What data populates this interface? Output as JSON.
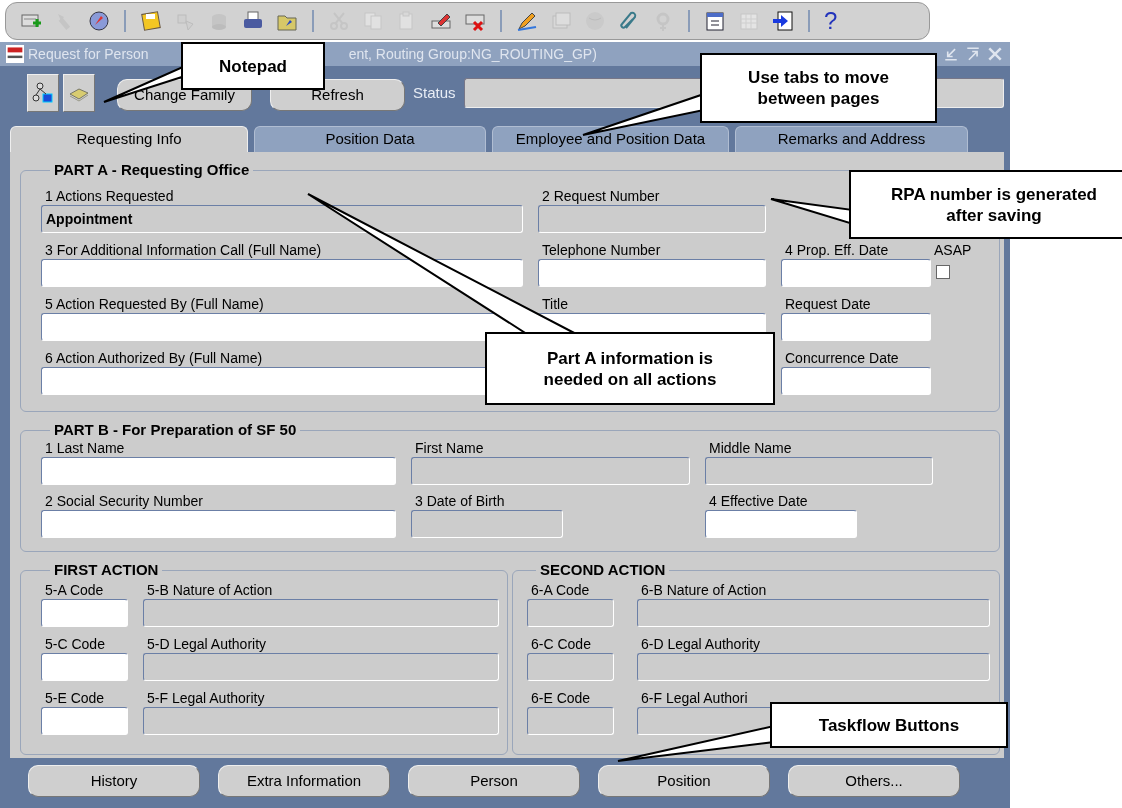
{
  "toolbar": [
    {
      "kind": "button",
      "disabled": false
    },
    {
      "kind": "button",
      "disabled": true
    },
    {
      "kind": "button",
      "disabled": false
    },
    {
      "kind": "separator"
    },
    {
      "kind": "button",
      "disabled": false
    },
    {
      "kind": "button",
      "disabled": true
    },
    {
      "kind": "button",
      "disabled": true
    },
    {
      "kind": "button",
      "disabled": false
    },
    {
      "kind": "button",
      "disabled": false
    },
    {
      "kind": "separator"
    },
    {
      "kind": "button",
      "disabled": true
    },
    {
      "kind": "button",
      "disabled": true
    },
    {
      "kind": "button",
      "disabled": true
    },
    {
      "kind": "button",
      "disabled": false
    },
    {
      "kind": "button",
      "disabled": false
    },
    {
      "kind": "separator"
    },
    {
      "kind": "button",
      "disabled": false
    },
    {
      "kind": "button",
      "disabled": true
    },
    {
      "kind": "button",
      "disabled": true
    },
    {
      "kind": "button",
      "disabled": false
    },
    {
      "kind": "button",
      "disabled": true
    },
    {
      "kind": "separator"
    },
    {
      "kind": "button",
      "disabled": false
    },
    {
      "kind": "button",
      "disabled": true
    },
    {
      "kind": "button",
      "disabled": false
    },
    {
      "kind": "separator"
    },
    {
      "kind": "text",
      "label": "?",
      "disabled": false
    }
  ],
  "window": {
    "title_start": "Request for Person",
    "title_end": "ent, Routing Group:NG_ROUTING_GP)"
  },
  "header_buttons": [
    {
      "kind": "icon"
    },
    {
      "kind": "icon"
    },
    {
      "kind": "text",
      "label": "Change Family"
    },
    {
      "kind": "text",
      "label": "Refresh"
    }
  ],
  "status": {
    "label": "Status"
  },
  "tabs": [
    {
      "label": "Requesting Info",
      "selected": true
    },
    {
      "label": "Position Data",
      "selected": false
    },
    {
      "label": "Employee and Position Data",
      "selected": false
    },
    {
      "label": "Remarks and Address",
      "selected": false
    }
  ],
  "part_a": {
    "title": "PART A - Requesting Office",
    "rows": [
      [
        {
          "kind": "text",
          "label": "1 Actions Requested",
          "value": "Appointment",
          "readonly": true
        },
        {
          "kind": "text",
          "label": "2 Request Number",
          "readonly": true
        },
        {
          "kind": "empty"
        },
        {
          "kind": "empty"
        }
      ],
      [
        {
          "kind": "text",
          "label": "3 For Additional Information Call (Full Name)",
          "readonly": false
        },
        {
          "kind": "text",
          "label": "Telephone Number",
          "readonly": false
        },
        {
          "kind": "text",
          "label": "4 Prop. Eff. Date",
          "readonly": false
        },
        {
          "kind": "checkbox",
          "label": "ASAP",
          "checked": false
        }
      ],
      [
        {
          "kind": "text",
          "label": "5 Action Requested By (Full Name)",
          "readonly": false
        },
        {
          "kind": "text",
          "label": "Title",
          "readonly": false
        },
        {
          "kind": "text",
          "label": "Request Date",
          "readonly": false
        },
        {
          "kind": "empty"
        }
      ],
      [
        {
          "kind": "text",
          "label": "6 Action Authorized By (Full Name)",
          "readonly": false
        },
        {
          "kind": "empty"
        },
        {
          "kind": "text",
          "label": "Concurrence Date",
          "readonly": false
        },
        {
          "kind": "empty"
        }
      ]
    ]
  },
  "part_b": {
    "title": "PART B - For Preparation of SF 50",
    "rows": [
      [
        {
          "kind": "text",
          "label": "1 Last Name",
          "readonly": false
        },
        {
          "kind": "text",
          "label": "First Name",
          "readonly": true
        },
        {
          "kind": "text",
          "label": "Middle Name",
          "readonly": true
        }
      ],
      [
        {
          "kind": "text",
          "label": "2 Social Security Number",
          "readonly": false
        },
        {
          "kind": "text",
          "label": "3 Date of Birth",
          "readonly": true
        },
        {
          "kind": "text",
          "label": "4 Effective Date",
          "readonly": false
        }
      ]
    ]
  },
  "first_action": {
    "title": "FIRST ACTION",
    "rows": [
      [
        {
          "kind": "text",
          "label": "5-A Code",
          "readonly": false
        },
        {
          "kind": "text",
          "label": "5-B Nature of Action",
          "readonly": true
        }
      ],
      [
        {
          "kind": "text",
          "label": "5-C Code",
          "readonly": false
        },
        {
          "kind": "text",
          "label": "5-D Legal Authority",
          "readonly": true
        }
      ],
      [
        {
          "kind": "text",
          "label": "5-E Code",
          "readonly": false
        },
        {
          "kind": "text",
          "label": "5-F Legal Authority",
          "readonly": true
        }
      ]
    ]
  },
  "second_action": {
    "title": "SECOND  ACTION",
    "rows": [
      [
        {
          "kind": "text",
          "label": "6-A Code",
          "readonly": true
        },
        {
          "kind": "text",
          "label": "6-B Nature of Action",
          "readonly": true
        }
      ],
      [
        {
          "kind": "text",
          "label": "6-C Code",
          "readonly": true
        },
        {
          "kind": "text",
          "label": "6-D Legal Authority",
          "readonly": true
        }
      ],
      [
        {
          "kind": "text",
          "label": "6-E Code",
          "readonly": true
        },
        {
          "kind": "text",
          "label": "6-F Legal Authori",
          "readonly": true
        }
      ]
    ]
  },
  "taskflow_buttons": [
    {
      "label": "History"
    },
    {
      "label": "Extra Information"
    },
    {
      "label": "Person"
    },
    {
      "label": "Position"
    },
    {
      "label": "Others..."
    }
  ],
  "callouts": [
    {
      "text": "Notepad"
    },
    {
      "text": "Use tabs to move between pages"
    },
    {
      "text": "RPA number is generated after saving"
    },
    {
      "text": "Part A information is needed on all actions"
    },
    {
      "text": "Taskflow Buttons"
    }
  ]
}
